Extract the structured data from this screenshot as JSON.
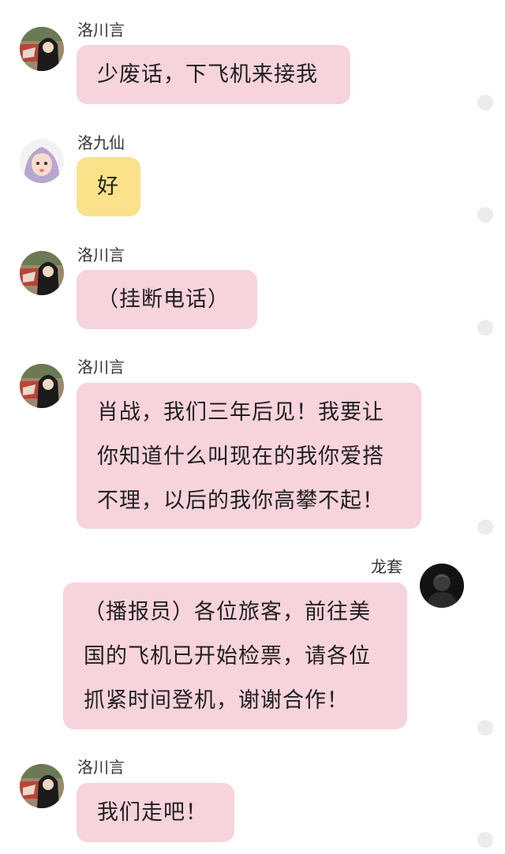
{
  "messages": [
    {
      "sender": "洛川言",
      "lines": [
        "少废话，下飞机来接我"
      ],
      "avatar": "girl-dark-hair-avatar",
      "side": "left",
      "bubble_color": "#f7d3dc"
    },
    {
      "sender": "洛九仙",
      "lines": [
        "好"
      ],
      "avatar": "girl-purple-hair-avatar",
      "side": "left",
      "bubble_color": "#fbe189"
    },
    {
      "sender": "洛川言",
      "lines": [
        "（挂断电话）"
      ],
      "avatar": "girl-dark-hair-avatar",
      "side": "left",
      "bubble_color": "#f7d3dc"
    },
    {
      "sender": "洛川言",
      "lines": [
        "肖战，我们三年后见！我要让",
        "你知道什么叫现在的我你爱搭",
        "不理，以后的我你高攀不起！"
      ],
      "avatar": "girl-dark-hair-avatar",
      "side": "left",
      "bubble_color": "#f7d3dc"
    },
    {
      "sender": "龙套",
      "lines": [
        "（播报员）各位旅客，前往美",
        "国的飞机已开始检票，请各位",
        "抓紧时间登机，谢谢合作！"
      ],
      "avatar": "dark-silhouette-avatar",
      "side": "right",
      "bubble_color": "#f7d3dc"
    },
    {
      "sender": "洛川言",
      "lines": [
        "我们走吧！"
      ],
      "avatar": "girl-dark-hair-avatar",
      "side": "left",
      "bubble_color": "#f7d3dc"
    }
  ]
}
